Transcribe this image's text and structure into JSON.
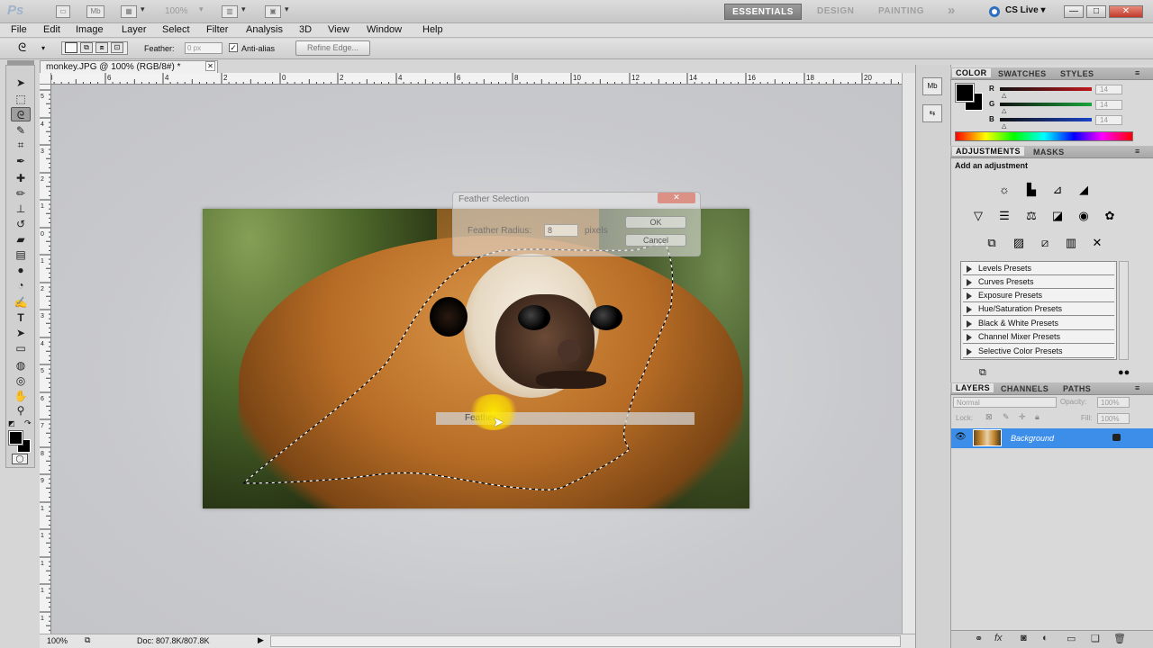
{
  "app": {
    "logo": "Ps",
    "zoom_level": "100%"
  },
  "workspaces": {
    "essentials": "ESSENTIALS",
    "design": "DESIGN",
    "painting": "PAINTING",
    "more": "»",
    "cs_live": "CS Live ▾"
  },
  "window_controls": {
    "minimize": "—",
    "restore": "□",
    "close": "✕"
  },
  "menu": [
    "File",
    "Edit",
    "Image",
    "Layer",
    "Select",
    "Filter",
    "Analysis",
    "3D",
    "View",
    "Window",
    "Help"
  ],
  "options_bar": {
    "feather_label": "Feather:",
    "feather_value": "0 px",
    "anti_alias_label": "Anti-alias",
    "anti_alias_checked": "✓",
    "refine_edge_label": "Refine Edge..."
  },
  "document": {
    "tab_title": "monkey.JPG @ 100% (RGB/8#) *",
    "tab_close": "✕"
  },
  "ruler_top_labels": [
    "8",
    "6",
    "4",
    "2",
    "0",
    "2",
    "4",
    "6",
    "8",
    "10",
    "12",
    "14",
    "16",
    "18",
    "20"
  ],
  "ruler_left_labels": [
    "5",
    "4",
    "3",
    "2",
    "1",
    "0",
    "1",
    "2",
    "3",
    "4",
    "5",
    "6",
    "7",
    "8",
    "9",
    "1",
    "1",
    "1",
    "1",
    "1"
  ],
  "status": {
    "zoom": "100%",
    "doc_info": "Doc: 807.8K/807.8K"
  },
  "feather_dialog": {
    "title": "Feather Selection",
    "radius_label": "Feather Radius:",
    "radius_value": "8",
    "units": "pixels",
    "ok_label": "OK",
    "cancel_label": "Cancel",
    "close": "✕"
  },
  "tooltip": {
    "text": "Feather"
  },
  "color_panel": {
    "tabs": [
      "COLOR",
      "SWATCHES",
      "STYLES"
    ],
    "r_label": "R",
    "g_label": "G",
    "b_label": "B",
    "r_value": "14",
    "g_value": "14",
    "b_value": "14",
    "r_color": "#c0181c",
    "g_color": "#1aa43c",
    "b_color": "#1a44c8"
  },
  "adjustments_panel": {
    "tabs": [
      "ADJUSTMENTS",
      "MASKS"
    ],
    "heading": "Add an adjustment",
    "presets": [
      "Levels Presets",
      "Curves Presets",
      "Exposure Presets",
      "Hue/Saturation Presets",
      "Black & White Presets",
      "Channel Mixer Presets",
      "Selective Color Presets"
    ]
  },
  "layers_panel": {
    "tabs": [
      "LAYERS",
      "CHANNELS",
      "PATHS"
    ],
    "blend_mode": "Normal",
    "opacity_label": "Opacity:",
    "opacity_value": "100%",
    "lock_label": "Lock:",
    "fill_label": "Fill:",
    "fill_value": "100%",
    "layer_name": "Background",
    "layer_eye": "👁"
  },
  "colors": {
    "accent_selected": "#3d8ee8",
    "workspace_active": "#8a8a8a"
  }
}
